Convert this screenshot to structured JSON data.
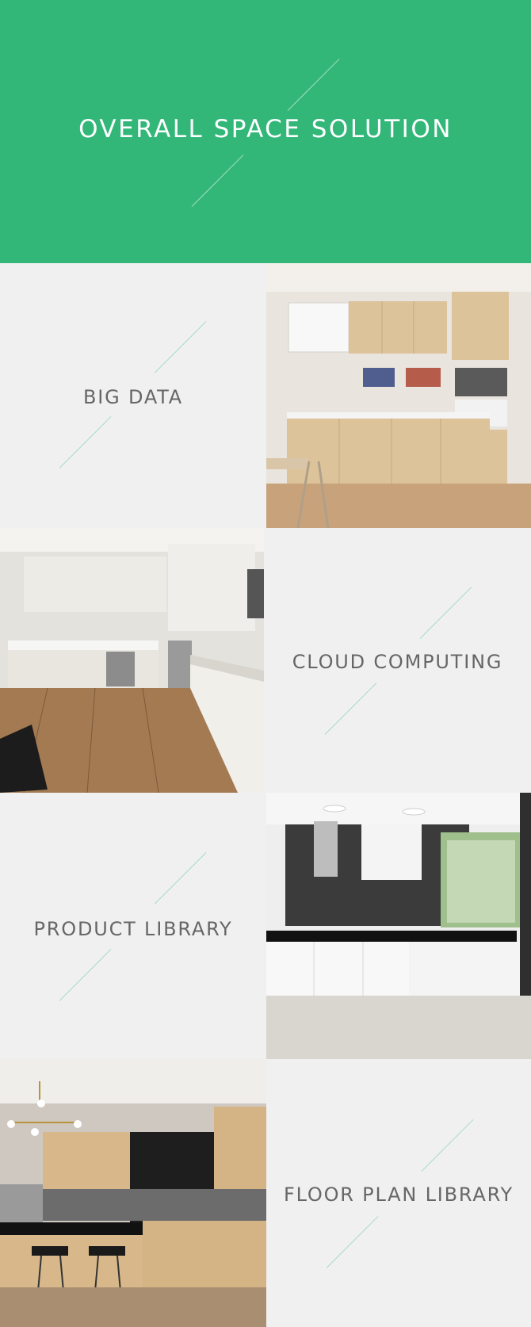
{
  "hero": {
    "title": "OVERALL SPACE SOLUTION"
  },
  "tiles": [
    {
      "label": "BIG DATA"
    },
    {
      "label": "CLOUD COMPUTING"
    },
    {
      "label": "PRODUCT LIBRARY"
    },
    {
      "label": "FLOOR PLAN LIBRARY"
    }
  ],
  "photos": [
    {
      "icon": "kitchen-photo-light-wood"
    },
    {
      "icon": "kitchen-photo-white-cabinets-wood-floor"
    },
    {
      "icon": "kitchen-photo-white-black-tile"
    },
    {
      "icon": "kitchen-photo-wood-island-pendant"
    }
  ],
  "colors": {
    "accent": "#32b779",
    "tile_bg": "#f0f0f0",
    "label_text": "#666666",
    "slash": "#a7dcc6"
  }
}
